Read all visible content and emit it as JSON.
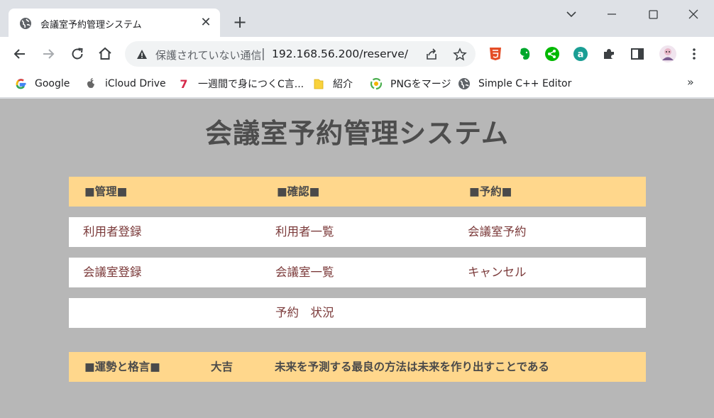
{
  "browser": {
    "tab": {
      "title": "会議室予約管理システム",
      "close_glyph": "✕"
    },
    "new_tab_glyph": "+",
    "window_controls": {
      "tabs_menu": "chevron-down-icon",
      "minimize": "minimize-icon",
      "maximize": "maximize-icon",
      "close": "close-icon"
    },
    "omnibox": {
      "security_label": "保護されていない通信",
      "separator": "|",
      "url": "192.168.56.200/reserve/"
    },
    "bookmarks": [
      {
        "label": "Google",
        "icon": "google-icon"
      },
      {
        "label": "iCloud Drive",
        "icon": "apple-icon"
      },
      {
        "label": "一週間で身につくC言...",
        "icon": "seven-icon"
      },
      {
        "label": "紹介",
        "icon": "folder-icon"
      },
      {
        "label": "PNGをマージ",
        "icon": "png-merge-icon"
      },
      {
        "label": "Simple C++ Editor",
        "icon": "globe-icon"
      }
    ],
    "bookmarks_more": "»",
    "colors": {
      "tab_strip": "#dee1e6",
      "omnibox": "#f1f3f4"
    }
  },
  "page": {
    "title": "会議室予約管理システム",
    "menu": {
      "headers": [
        "■管理■",
        "■確認■",
        "■予約■"
      ],
      "rows": [
        [
          "利用者登録",
          "利用者一覧",
          "会議室予約"
        ],
        [
          "会議室登録",
          "会議室一覧",
          "キャンセル"
        ],
        [
          "",
          "予約　状況",
          ""
        ]
      ]
    },
    "fortune": {
      "label": "■運勢と格言■",
      "result": "大吉",
      "quote": "未来を予測する最良の方法は未来を作り出すことである"
    },
    "colors": {
      "background": "#b7b7b7",
      "header_bg": "#ffd78c",
      "row_bg": "#ffffff",
      "link_text": "#7b3a3a",
      "title_text": "#4d4d4d"
    }
  }
}
